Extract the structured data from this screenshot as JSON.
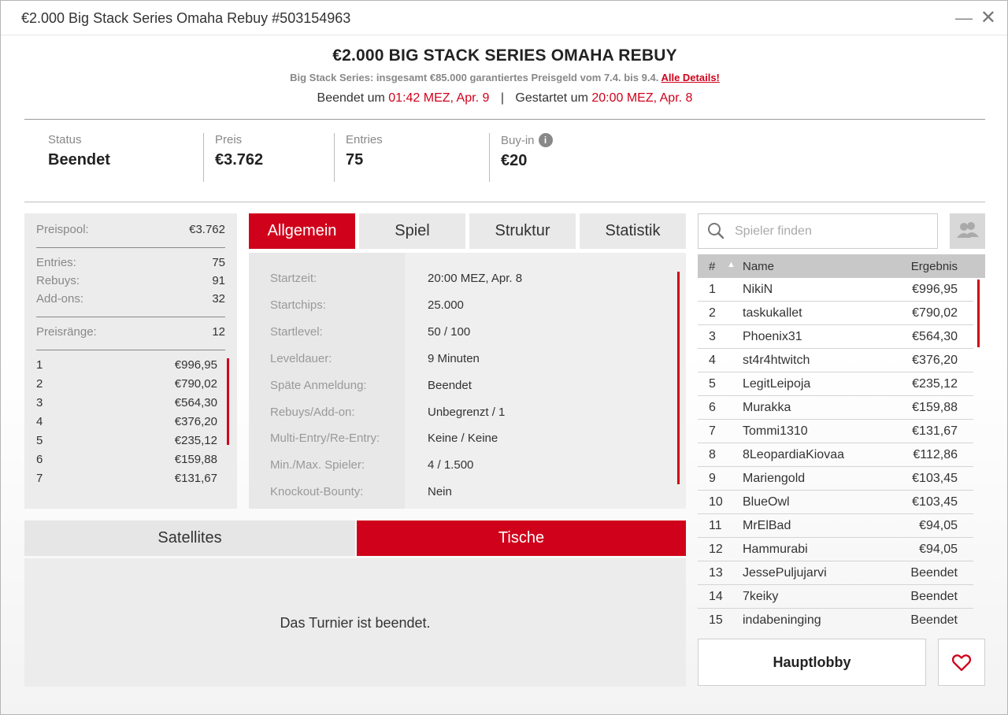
{
  "window": {
    "title": "€2.000 Big Stack Series Omaha Rebuy #503154963",
    "minimize": "—",
    "close": "✕"
  },
  "header": {
    "name": "€2.000 BIG STACK SERIES OMAHA REBUY",
    "subtitle": "Big Stack Series: insgesamt €85.000 garantiertes Preisgeld vom 7.4. bis 9.4.",
    "details_link": "Alle Details!",
    "ended_label": "Beendet um",
    "ended_value": "01:42 MEZ, Apr. 9",
    "pipe": "|",
    "started_label": "Gestartet um",
    "started_value": "20:00 MEZ, Apr. 8"
  },
  "stats": {
    "status_label": "Status",
    "status_value": "Beendet",
    "prize_label": "Preis",
    "prize_value": "€3.762",
    "entries_label": "Entries",
    "entries_value": "75",
    "buyin_label": "Buy-in",
    "buyin_value": "€20",
    "info_glyph": "i"
  },
  "prize": {
    "pool_label": "Preispool:",
    "pool_value": "€3.762",
    "entries_label": "Entries:",
    "entries_value": "75",
    "rebuys_label": "Rebuys:",
    "rebuys_value": "91",
    "addons_label": "Add-ons:",
    "addons_value": "32",
    "ranks_label": "Preisränge:",
    "ranks_value": "12",
    "ranks": [
      {
        "pos": "1",
        "amount": "€996,95"
      },
      {
        "pos": "2",
        "amount": "€790,02"
      },
      {
        "pos": "3",
        "amount": "€564,30"
      },
      {
        "pos": "4",
        "amount": "€376,20"
      },
      {
        "pos": "5",
        "amount": "€235,12"
      },
      {
        "pos": "6",
        "amount": "€159,88"
      },
      {
        "pos": "7",
        "amount": "€131,67"
      }
    ]
  },
  "tabs": [
    "Allgemein",
    "Spiel",
    "Struktur",
    "Statistik"
  ],
  "details": [
    {
      "k": "Startzeit:",
      "v": "20:00 MEZ, Apr. 8"
    },
    {
      "k": "Startchips:",
      "v": "25.000"
    },
    {
      "k": "Startlevel:",
      "v": "50 / 100"
    },
    {
      "k": "Leveldauer:",
      "v": "9 Minuten"
    },
    {
      "k": "Späte Anmeldung:",
      "v": "Beendet"
    },
    {
      "k": "Rebuys/Add-on:",
      "v": "Unbegrenzt / 1"
    },
    {
      "k": "Multi-Entry/Re-Entry:",
      "v": "Keine / Keine"
    },
    {
      "k": "Min./Max. Spieler:",
      "v": "4 / 1.500"
    },
    {
      "k": "Knockout-Bounty:",
      "v": "Nein"
    }
  ],
  "bottom_tabs": {
    "satellites": "Satellites",
    "tables": "Tische"
  },
  "bottom_message": "Das Turnier ist beendet.",
  "search": {
    "placeholder": "Spieler finden"
  },
  "players": {
    "headers": {
      "rank": "#",
      "name": "Name",
      "result": "Ergebnis",
      "sort_glyph": "▲"
    },
    "rows": [
      {
        "rank": "1",
        "name": "NikiN",
        "result": "€996,95"
      },
      {
        "rank": "2",
        "name": "taskukallet",
        "result": "€790,02"
      },
      {
        "rank": "3",
        "name": "Phoenix31",
        "result": "€564,30"
      },
      {
        "rank": "4",
        "name": "st4r4htwitch",
        "result": "€376,20"
      },
      {
        "rank": "5",
        "name": "LegitLeipoja",
        "result": "€235,12"
      },
      {
        "rank": "6",
        "name": "Murakka",
        "result": "€159,88"
      },
      {
        "rank": "7",
        "name": "Tommi1310",
        "result": "€131,67"
      },
      {
        "rank": "8",
        "name": "8LeopardiaKiovaa",
        "result": "€112,86"
      },
      {
        "rank": "9",
        "name": "Mariengold",
        "result": "€103,45"
      },
      {
        "rank": "10",
        "name": "BlueOwl",
        "result": "€103,45"
      },
      {
        "rank": "11",
        "name": "MrElBad",
        "result": "€94,05"
      },
      {
        "rank": "12",
        "name": "Hammurabi",
        "result": "€94,05"
      },
      {
        "rank": "13",
        "name": "JessePuljujarvi",
        "result": "Beendet"
      },
      {
        "rank": "14",
        "name": "7keiky",
        "result": "Beendet"
      },
      {
        "rank": "15",
        "name": "indabeninging",
        "result": "Beendet"
      }
    ]
  },
  "buttons": {
    "main_lobby": "Hauptlobby"
  },
  "icons": {
    "search": "search-icon",
    "friends": "friends-icon",
    "favorite": "heart-icon",
    "info": "info-icon"
  },
  "colors": {
    "accent": "#d0021b",
    "panel": "#ececec",
    "muted_text": "#888888"
  }
}
